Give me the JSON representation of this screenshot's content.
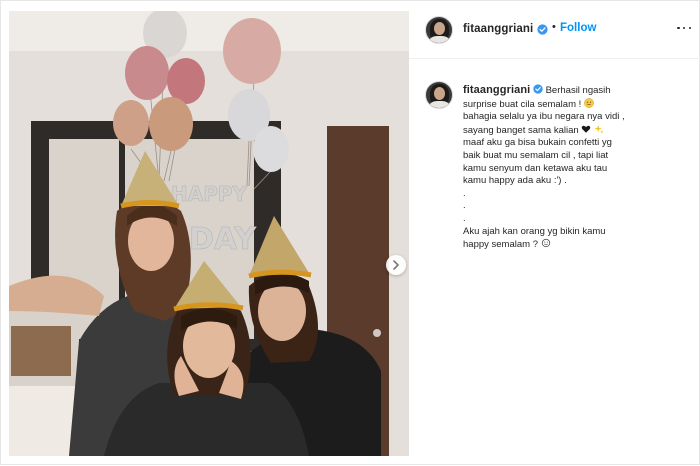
{
  "post": {
    "username": "fitaanggriani",
    "follow_label": "Follow",
    "separator": "•",
    "more_icon": "more-horizontal-icon",
    "photo": {
      "balloon_text": "HAPPY DAY",
      "next_icon": "chevron-right-icon"
    },
    "caption": {
      "username": "fitaanggriani",
      "lines": [
        "Berhasil ngasih",
        "surprise buat cila semalam !",
        "bahagia selalu ya ibu negara nya vidi ,",
        "sayang banget sama kalian",
        "maaf aku ga bisa bukain confetti yg",
        "baik buat mu semalam cil , tapi liat",
        "kamu senyum dan ketawa aku tau",
        "kamu happy ada aku :') .",
        ".",
        ".",
        ".",
        "Aku ajah kan orang yg bikin kamu",
        "happy semalam ?"
      ]
    },
    "colors": {
      "accent": "#0095f6",
      "verified": "#3897f0"
    }
  }
}
